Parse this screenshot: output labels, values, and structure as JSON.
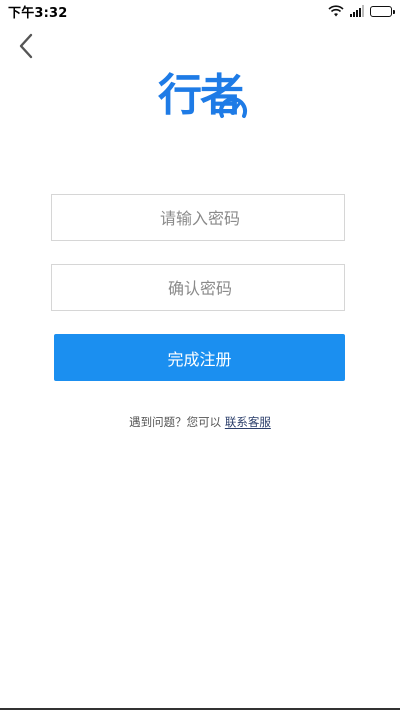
{
  "status_bar": {
    "time": "下午3:32"
  },
  "icons": {
    "back": "chevron-left-icon",
    "wifi": "wifi-icon",
    "signal": "signal-icon",
    "battery": "battery-icon",
    "logo_gauge": "speedometer-icon"
  },
  "logo": {
    "text": "行者"
  },
  "form": {
    "password_placeholder": "请输入密码",
    "confirm_placeholder": "确认密码",
    "submit_label": "完成注册"
  },
  "help": {
    "prompt": "遇到问题？您可以 ",
    "link": "联系客服"
  },
  "colors": {
    "brand": "#1e7be6",
    "button": "#1b8ff0",
    "link": "#2b3e6b"
  }
}
